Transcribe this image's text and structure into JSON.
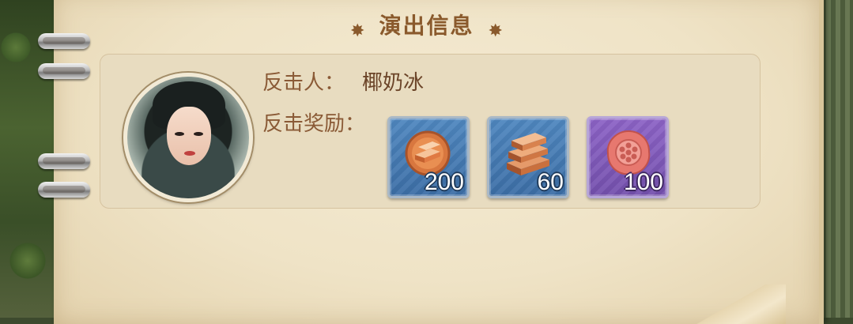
{
  "header": {
    "title": "演出信息"
  },
  "info": {
    "attacker_label": "反击人：",
    "attacker_name": "椰奶冰",
    "reward_label": "反击奖励："
  },
  "rewards": [
    {
      "icon": "copper-coin-icon",
      "count": "200",
      "rarity_color": "#4f87bf"
    },
    {
      "icon": "copper-ingot-stack-icon",
      "count": "60",
      "rarity_color": "#4f87bf"
    },
    {
      "icon": "red-wax-seal-icon",
      "count": "100",
      "rarity_color": "#8c63c6"
    }
  ],
  "colors": {
    "title": "#8a5a2c",
    "paper": "#efe3c6",
    "panel": "#e8dcc0"
  }
}
